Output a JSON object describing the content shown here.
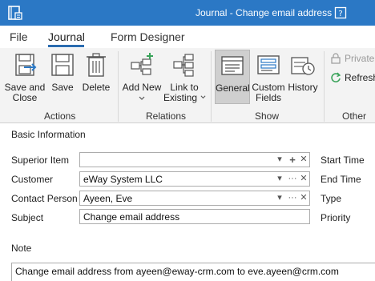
{
  "window": {
    "title": "Journal - Change email address",
    "app_icon": "journal-app-icon",
    "help_icon": "help-icon"
  },
  "menu_tabs": [
    {
      "label": "File"
    },
    {
      "label": "Journal",
      "active": true
    },
    {
      "label": "Form Designer"
    }
  ],
  "ribbon": {
    "actions": {
      "group_label": "Actions",
      "save_and_close": {
        "line1": "Save and",
        "line2": "Close",
        "icon": "save-and-close-icon"
      },
      "save": {
        "label": "Save",
        "icon": "save-icon"
      },
      "delete": {
        "label": "Delete",
        "icon": "trash-icon"
      }
    },
    "relations": {
      "group_label": "Relations",
      "add_new": {
        "label": "Add New",
        "icon": "add-relation-icon"
      },
      "link_existing": {
        "line1": "Link to",
        "line2": "Existing",
        "icon": "link-relation-icon"
      }
    },
    "show": {
      "group_label": "Show",
      "general": {
        "label": "General",
        "icon": "general-view-icon",
        "selected": true
      },
      "custom_fields": {
        "line1": "Custom",
        "line2": "Fields",
        "icon": "custom-fields-icon"
      },
      "history": {
        "label": "History",
        "icon": "history-icon"
      }
    },
    "other": {
      "group_label": "Other",
      "private": {
        "label": "Private",
        "icon": "lock-icon",
        "disabled": true
      },
      "refresh": {
        "label": "Refresh",
        "icon": "refresh-icon"
      }
    }
  },
  "form": {
    "section_title": "Basic Information",
    "fields": {
      "superior_item": {
        "label": "Superior Item",
        "value": ""
      },
      "customer": {
        "label": "Customer",
        "value": "eWay System LLC"
      },
      "contact_person": {
        "label": "Contact Person",
        "value": "Ayeen, Eve"
      },
      "subject": {
        "label": "Subject",
        "value": "Change email address"
      }
    },
    "right_labels": {
      "start_time": "Start Time",
      "end_time": "End Time",
      "type": "Type",
      "priority": "Priority"
    },
    "note": {
      "label": "Note",
      "value": "Change email address from ayeen@eway-crm.com to eve.ayeen@crm.com"
    }
  },
  "colors": {
    "titlebar": "#2b78c5",
    "ribbon_bg": "#f3f3f3",
    "accent_green": "#3aa35a",
    "tab_underline": "#2b6cb0"
  }
}
